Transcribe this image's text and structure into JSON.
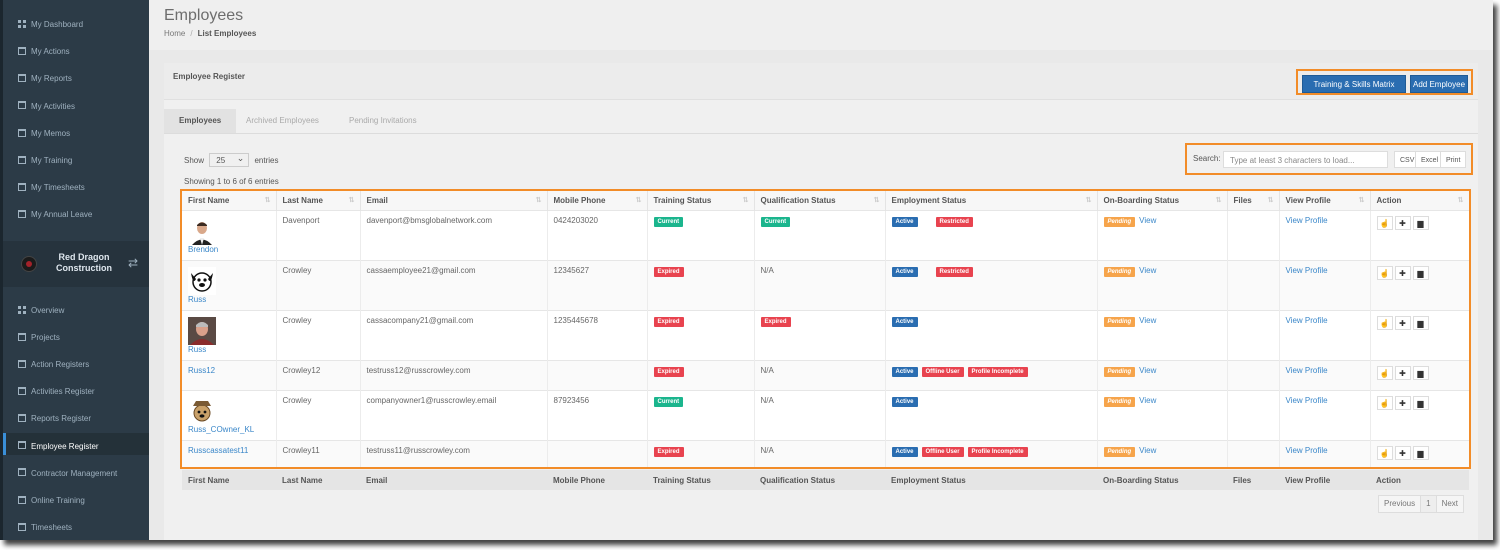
{
  "sidebar": {
    "top_items": [
      {
        "label": "My Dashboard",
        "icon": "grid-icon"
      },
      {
        "label": "My Actions",
        "icon": "calendar-icon"
      },
      {
        "label": "My Reports",
        "icon": "calendar-icon"
      },
      {
        "label": "My Activities",
        "icon": "calendar-icon"
      },
      {
        "label": "My Memos",
        "icon": "calendar-icon"
      },
      {
        "label": "My Training",
        "icon": "graduation-cap-icon"
      },
      {
        "label": "My Timesheets",
        "icon": "calendar-icon"
      },
      {
        "label": "My Annual Leave",
        "icon": "calendar-icon"
      }
    ],
    "company_name": "Red Dragon Construction",
    "bottom_items": [
      {
        "label": "Overview",
        "icon": "grid-icon"
      },
      {
        "label": "Projects",
        "icon": "sitemap-icon"
      },
      {
        "label": "Action Registers",
        "icon": "calendar-icon"
      },
      {
        "label": "Activities Register",
        "icon": "calendar-icon"
      },
      {
        "label": "Reports Register",
        "icon": "calendar-icon"
      },
      {
        "label": "Employee Register",
        "icon": "users-icon",
        "active": true
      },
      {
        "label": "Contractor Management",
        "icon": "users-icon"
      },
      {
        "label": "Online Training",
        "icon": "monitor-icon"
      },
      {
        "label": "Timesheets",
        "icon": "calendar-icon"
      }
    ]
  },
  "header": {
    "title": "Employees",
    "breadcrumb": [
      "Home",
      "List Employees"
    ]
  },
  "panel": {
    "title": "Employee Register",
    "buttons": {
      "matrix": "Training & Skills Matrix",
      "add": "Add Employee"
    },
    "tabs": [
      "Employees",
      "Archived Employees",
      "Pending Invitations"
    ]
  },
  "controls": {
    "show_label": "Show",
    "page_size": "25",
    "entries_label": "entries",
    "info": "Showing 1 to 6 of 6 entries",
    "search_label": "Search:",
    "search_placeholder": "Type at least 3 characters to load...",
    "exports": [
      "CSV",
      "Excel",
      "Print"
    ]
  },
  "table": {
    "columns": [
      "First Name",
      "Last Name",
      "Email",
      "Mobile Phone",
      "Training Status",
      "Qualification Status",
      "Employment Status",
      "On-Boarding Status",
      "Files",
      "View Profile",
      "Action"
    ],
    "rows": [
      {
        "first": "Brendon",
        "avatar": "man-in-suit-photo",
        "last": "Davenport",
        "email": "davenport@bmsglobalnetwork.com",
        "phone": "0424203020",
        "training": "Current",
        "qualification": {
          "type": "badge",
          "text": "Current",
          "color": "#1bb58d"
        },
        "employment": [
          {
            "text": "Active",
            "color": "#2a6db1"
          },
          {
            "text": "Restricted",
            "color": "#e8434f"
          }
        ],
        "onboarding": "Pending",
        "onboarding_link": "View",
        "profile": "View Profile"
      },
      {
        "first": "Russ",
        "avatar": "cartoon-dog-icon",
        "last": "Crowley",
        "email": "cassaemployee21@gmail.com",
        "phone": "12345627",
        "training": "Expired",
        "qualification": {
          "type": "text",
          "text": "N/A"
        },
        "employment": [
          {
            "text": "Active",
            "color": "#2a6db1"
          },
          {
            "text": "Restricted",
            "color": "#e8434f"
          }
        ],
        "onboarding": "Pending",
        "onboarding_link": "View",
        "profile": "View Profile"
      },
      {
        "first": "Russ",
        "avatar": "man-portrait-photo",
        "last": "Crowley",
        "email": "cassacompany21@gmail.com",
        "phone": "1235445678",
        "training": "Expired",
        "qualification": {
          "type": "badge",
          "text": "Expired",
          "color": "#e8434f"
        },
        "employment": [
          {
            "text": "Active",
            "color": "#2a6db1"
          }
        ],
        "onboarding": "Pending",
        "onboarding_link": "View",
        "profile": "View Profile"
      },
      {
        "first": "Russ12",
        "avatar": "",
        "last": "Crowley12",
        "email": "testruss12@russcrowley.com",
        "phone": "",
        "training": "Expired",
        "qualification": {
          "type": "text",
          "text": "N/A"
        },
        "employment": [
          {
            "text": "Active",
            "color": "#2a6db1"
          },
          {
            "text": "Offline User",
            "color": "#e8434f"
          },
          {
            "text": "Profile Incomplete",
            "color": "#e8434f"
          }
        ],
        "onboarding": "Pending",
        "onboarding_link": "View",
        "profile": "View Profile"
      },
      {
        "first": "Russ_COwner_KL",
        "avatar": "cartoon-dog-hat-icon",
        "last": "Crowley",
        "email": "companyowner1@russcrowley.email",
        "phone": "87923456",
        "training": "Current",
        "qualification": {
          "type": "text",
          "text": "N/A"
        },
        "employment": [
          {
            "text": "Active",
            "color": "#2a6db1"
          }
        ],
        "onboarding": "Pending",
        "onboarding_link": "View",
        "profile": "View Profile"
      },
      {
        "first": "Russcassatest11",
        "avatar": "",
        "last": "Crowley11",
        "email": "testruss11@russcrowley.com",
        "phone": "",
        "training": "Expired",
        "qualification": {
          "type": "text",
          "text": "N/A"
        },
        "employment": [
          {
            "text": "Active",
            "color": "#2a6db1"
          },
          {
            "text": "Offline User",
            "color": "#e8434f"
          },
          {
            "text": "Profile Incomplete",
            "color": "#e8434f"
          }
        ],
        "onboarding": "Pending",
        "onboarding_link": "View",
        "profile": "View Profile"
      }
    ],
    "action_icons": [
      "hand-icon",
      "plus-icon",
      "archive-icon"
    ]
  },
  "pagination": {
    "previous": "Previous",
    "page": "1",
    "next": "Next"
  },
  "colors": {
    "accent": "#2a6db1",
    "highlight": "#f28c28",
    "success": "#1bb58d",
    "danger": "#e8434f",
    "warning": "#f6a44b",
    "sidebar": "#2c3b47"
  }
}
